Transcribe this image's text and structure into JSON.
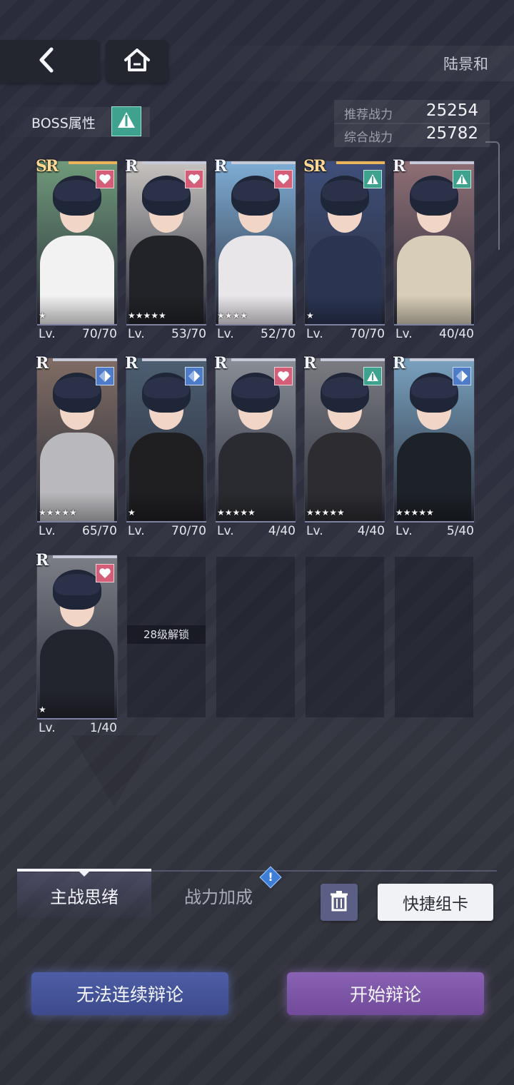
{
  "header": {
    "title": "陆景和",
    "back_icon": "chevron-left-icon",
    "home_icon": "home-icon"
  },
  "boss": {
    "label": "BOSS属性",
    "attribute_icon": "triangle-attribute-icon",
    "attribute_color": "#3ea28f"
  },
  "power": {
    "recommended_label": "推荐战力",
    "recommended_value": "25254",
    "total_label": "综合战力",
    "total_value": "25782"
  },
  "cards": [
    {
      "rarity": "SR",
      "badge": "heart",
      "stars": "★",
      "lv_label": "Lv.",
      "level": "70/70",
      "bg": "#6f9a7a",
      "outfit": "#f2f2f2"
    },
    {
      "rarity": "R",
      "badge": "heart",
      "stars": "★★★★★",
      "lv_label": "Lv.",
      "level": "53/70",
      "bg": "#c7c3c0",
      "outfit": "#222328"
    },
    {
      "rarity": "R",
      "badge": "heart",
      "stars": "★★★★",
      "lv_label": "Lv.",
      "level": "52/70",
      "bg": "#7faed6",
      "outfit": "#e9e6ea"
    },
    {
      "rarity": "SR",
      "badge": "triangle",
      "stars": "★",
      "lv_label": "Lv.",
      "level": "70/70",
      "bg": "#3f4f7a",
      "outfit": "#2b3552"
    },
    {
      "rarity": "R",
      "badge": "triangle",
      "stars": "",
      "lv_label": "Lv.",
      "level": "40/40",
      "bg": "#8f6f75",
      "outfit": "#d8cdb8"
    },
    {
      "rarity": "R",
      "badge": "diamond",
      "stars": "★★★★★",
      "lv_label": "Lv.",
      "level": "65/70",
      "bg": "#806d64",
      "outfit": "#b9b9bd"
    },
    {
      "rarity": "R",
      "badge": "diamond",
      "stars": "★",
      "lv_label": "Lv.",
      "level": "70/70",
      "bg": "#4d5f73",
      "outfit": "#1f1f22"
    },
    {
      "rarity": "R",
      "badge": "heart",
      "stars": "★★★★★",
      "lv_label": "Lv.",
      "level": "4/40",
      "bg": "#8a8f97",
      "outfit": "#2a2b30"
    },
    {
      "rarity": "R",
      "badge": "triangle",
      "stars": "★★★★★",
      "lv_label": "Lv.",
      "level": "4/40",
      "bg": "#7c7d83",
      "outfit": "#2c2c31"
    },
    {
      "rarity": "R",
      "badge": "diamond",
      "stars": "★★★★★",
      "lv_label": "Lv.",
      "level": "5/40",
      "bg": "#79a2c0",
      "outfit": "#1d2128"
    },
    {
      "rarity": "R",
      "badge": "heart",
      "stars": "★",
      "lv_label": "Lv.",
      "level": "1/40",
      "bg": "#7c7f86",
      "outfit": "#23252e"
    }
  ],
  "locked_slot": {
    "label": "28级解锁"
  },
  "tabs": [
    {
      "label": "主战思绪"
    },
    {
      "label": "战力加成"
    }
  ],
  "alert_icon": "exclamation-diamond-icon",
  "actions": {
    "delete_icon": "trash-icon",
    "quick_label": "快捷组卡",
    "cannot_continue_label": "无法连续辩论",
    "start_label": "开始辩论"
  },
  "colors": {
    "heart_badge": "#d45d77",
    "triangle_badge": "#3ea28f",
    "diamond_badge": "#4e7cc9"
  }
}
